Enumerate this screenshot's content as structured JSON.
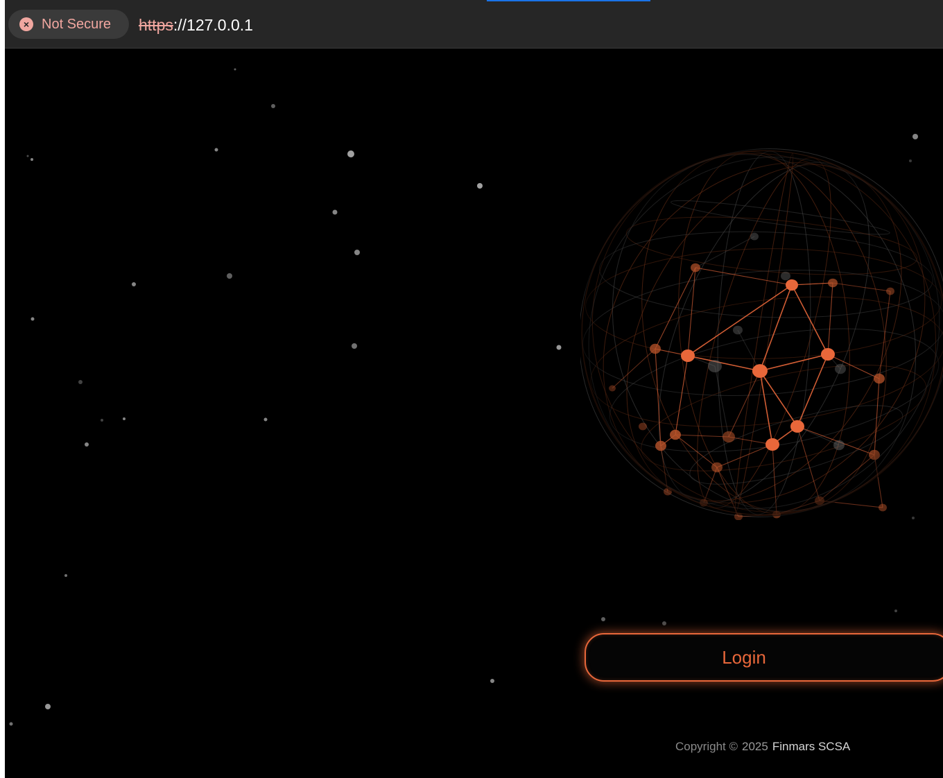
{
  "browser": {
    "security_label": "Not Secure",
    "security_icon": "warning-x-icon",
    "url_scheme": "https",
    "url_rest": "://127.0.0.1"
  },
  "login": {
    "button_label": "Login"
  },
  "footer": {
    "copyright_prefix": "Copyright ©",
    "year": "2025",
    "company": "Finmars SCSA"
  },
  "colors": {
    "accent": "#e8673a",
    "background": "#000000",
    "warning": "#f1a7a0"
  }
}
